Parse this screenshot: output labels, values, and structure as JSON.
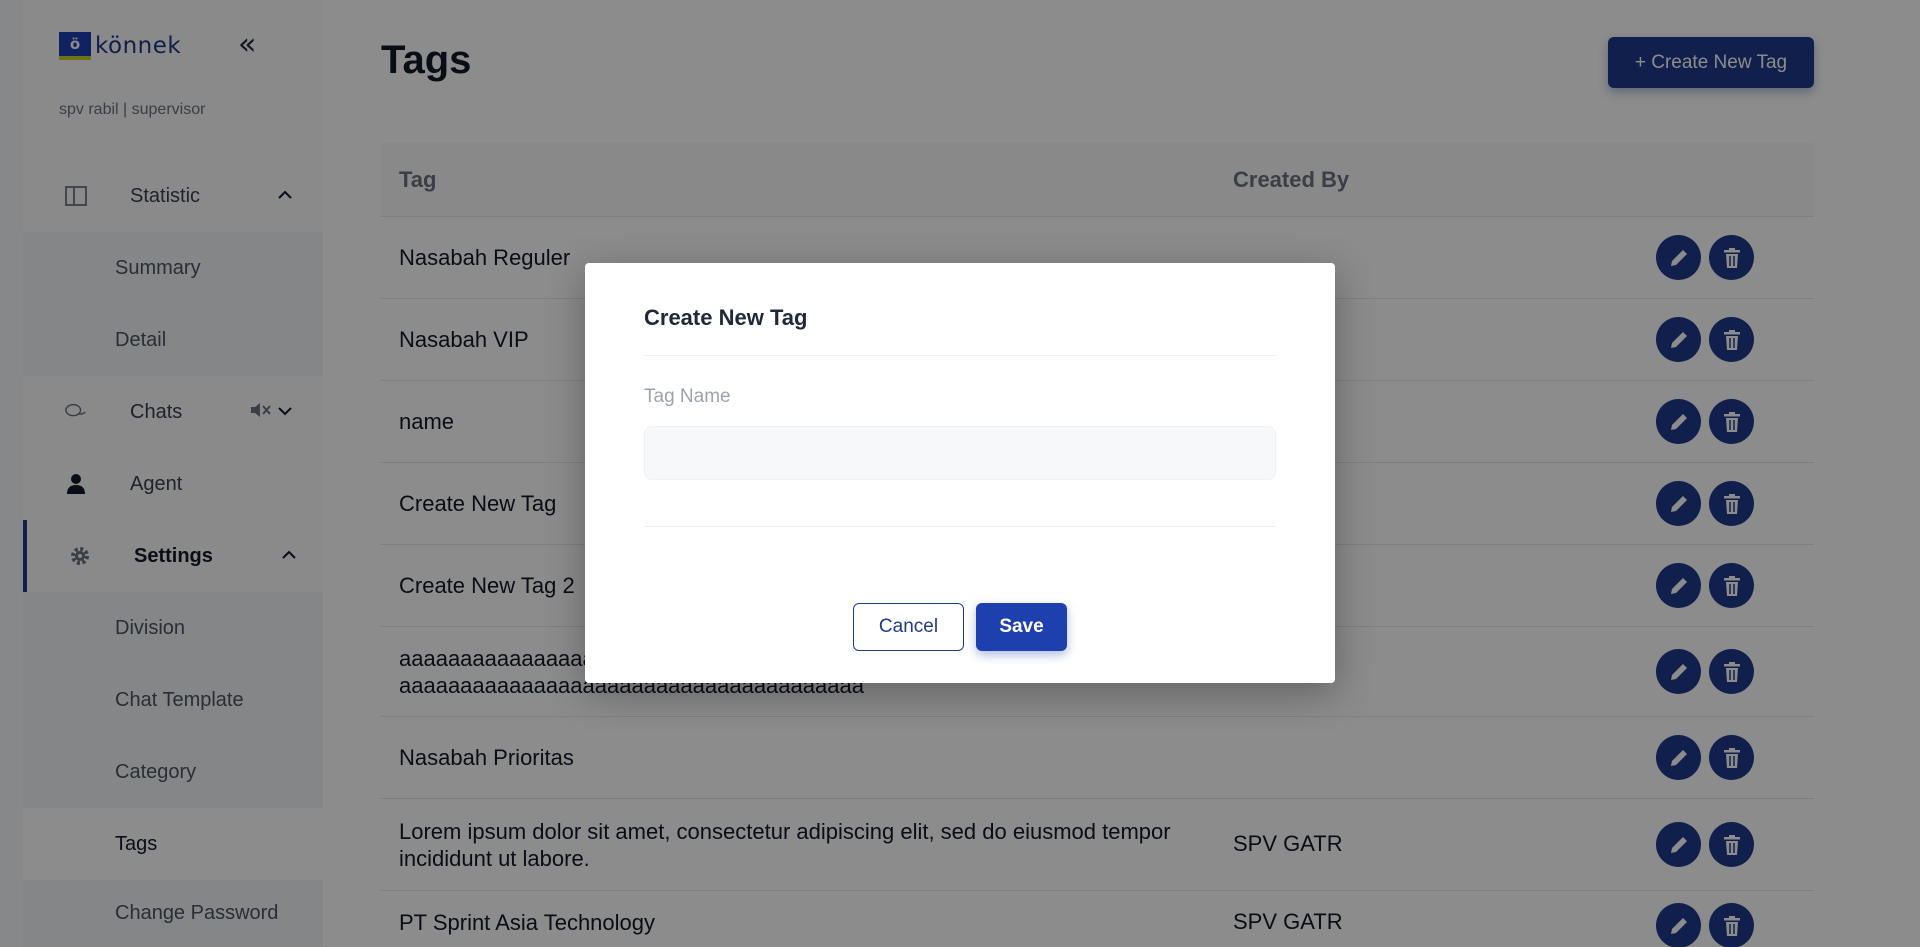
{
  "app": {
    "logo_mark": "ö",
    "logo_text": "könnek",
    "user_line": "spv rabil | supervisor"
  },
  "sidebar": {
    "collapse_icon": "«",
    "groups": [
      {
        "label": "Statistic",
        "icon": "layout-icon",
        "chevron": "⌃"
      },
      {
        "label": "Chats",
        "icon": "chat-icon",
        "chevron": "⌄",
        "extra_icon": "mute-icon"
      },
      {
        "label": "Agent",
        "icon": "user-icon"
      },
      {
        "label": "Settings",
        "icon": "gear-icon",
        "chevron": "⌃"
      }
    ],
    "statistic_items": [
      "Summary",
      "Detail"
    ],
    "settings_items": [
      "Division",
      "Chat Template",
      "Category",
      "Tags",
      "Change Password"
    ]
  },
  "main": {
    "title": "Tags",
    "create_label": "+ Create New Tag",
    "columns": {
      "tag": "Tag",
      "created_by": "Created By"
    },
    "rows": [
      {
        "tag": "Nasabah Reguler",
        "created_by": ""
      },
      {
        "tag": "Nasabah VIP",
        "created_by": ""
      },
      {
        "tag": "name",
        "created_by": ""
      },
      {
        "tag": "Create New Tag",
        "created_by": ""
      },
      {
        "tag": "Create New Tag 2",
        "created_by": ""
      },
      {
        "tag": "aaaaaaaaaaaaaaaaaaaaaaaaaaaaaaaaaaaaaaa aaaaaaaaaaaaaaaaaaaaaaaaaaaaaaaaaaaaaaa",
        "created_by": ""
      },
      {
        "tag": "Nasabah Prioritas",
        "created_by": ""
      },
      {
        "tag": "Lorem ipsum dolor sit amet, consectetur adipiscing elit, sed do eiusmod tempor incididunt ut labore.",
        "created_by": "SPV GATR"
      },
      {
        "tag": "PT Sprint Asia Technology",
        "created_by": "SPV GATR"
      }
    ]
  },
  "modal": {
    "title": "Create New Tag",
    "field_label": "Tag Name",
    "field_value": "",
    "cancel_label": "Cancel",
    "save_label": "Save"
  },
  "colors": {
    "primary": "#1e3a8a",
    "overlay": "rgba(0,0,0,0.45)"
  }
}
